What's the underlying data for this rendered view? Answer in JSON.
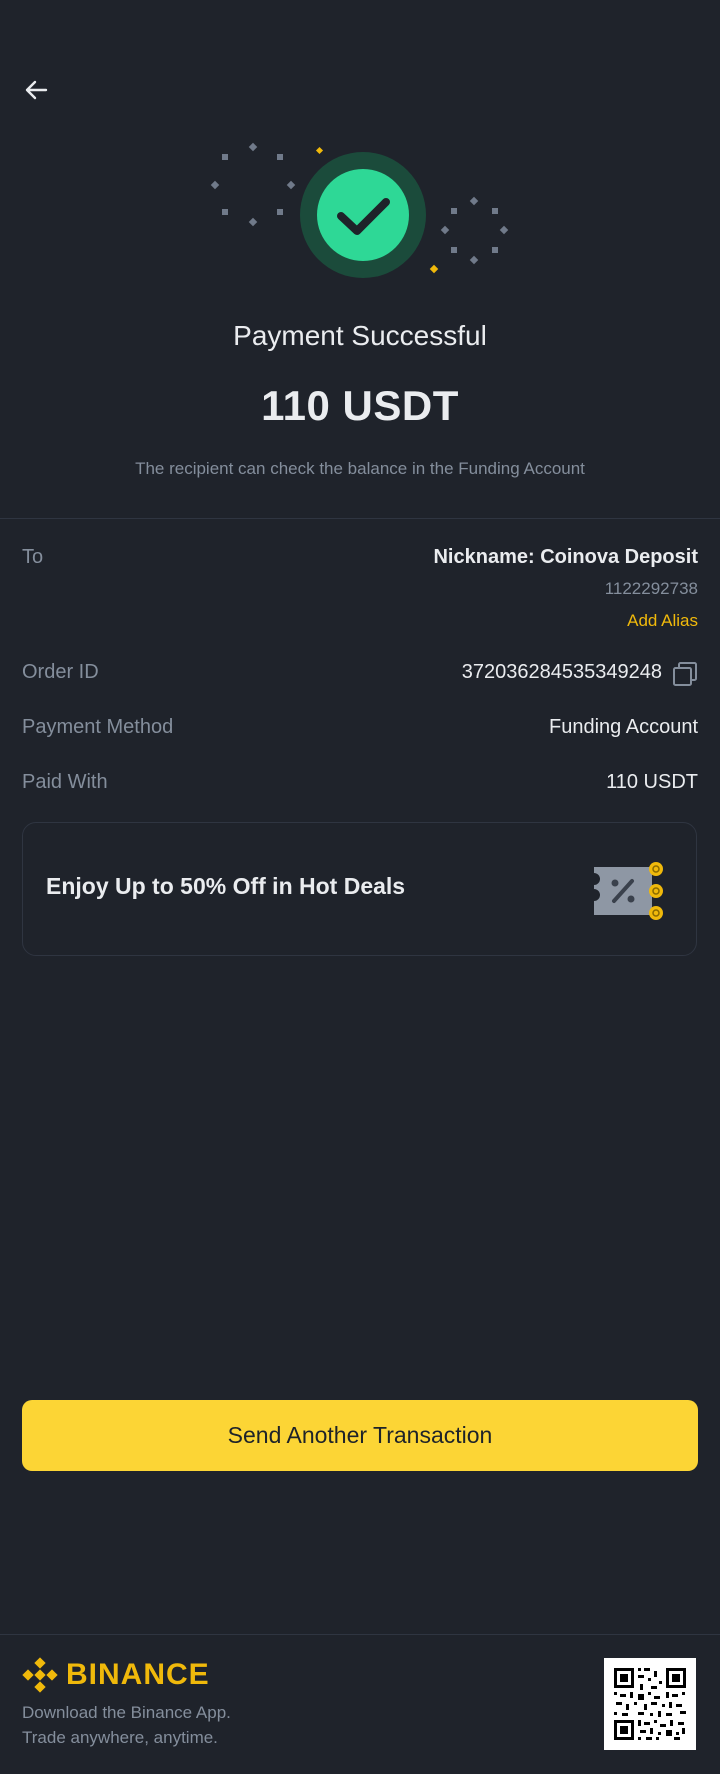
{
  "header": {
    "back_icon": "arrow-left-icon"
  },
  "status": {
    "title": "Payment Successful",
    "amount": "110 USDT",
    "subtitle": "The recipient can check the balance in the Funding Account",
    "icon": "check-circle-icon",
    "accent_color": "#2ebd85"
  },
  "details": {
    "to": {
      "label": "To",
      "nickname": "Nickname: Coinova Deposit",
      "id": "1122292738",
      "add_alias": "Add Alias"
    },
    "order_id": {
      "label": "Order ID",
      "value": "372036284535349248",
      "copy_icon": "copy-icon"
    },
    "payment_method": {
      "label": "Payment Method",
      "value": "Funding Account"
    },
    "paid_with": {
      "label": "Paid With",
      "value": "110 USDT"
    }
  },
  "promo": {
    "text": "Enjoy Up to 50% Off in Hot Deals",
    "icon": "discount-ticket-icon"
  },
  "cta": {
    "label": "Send Another Transaction",
    "color": "#fcd535"
  },
  "footer": {
    "brand": "BINANCE",
    "brand_color": "#f0b90b",
    "line1": "Download the Binance App.",
    "line2": "Trade anywhere, anytime.",
    "qr_icon": "qr-code-icon"
  }
}
